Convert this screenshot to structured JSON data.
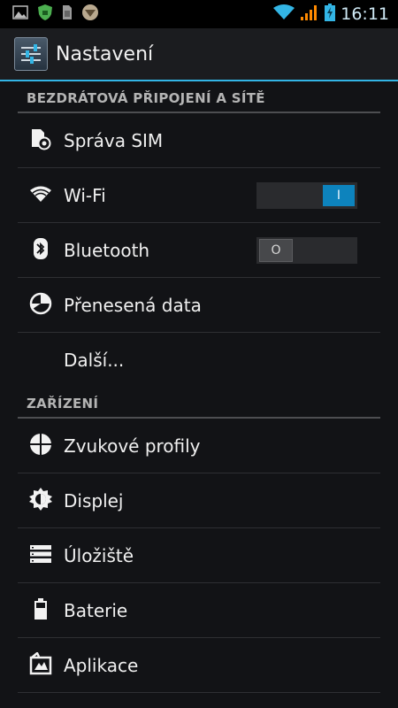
{
  "status_bar": {
    "time": "16:11",
    "icons": [
      "gallery-icon",
      "shield-icon",
      "sim-card-icon",
      "badge-icon",
      "wifi-icon",
      "signal-icon",
      "battery-charging-icon"
    ]
  },
  "action_bar": {
    "title": "Nastavení",
    "icon": "settings-sliders-icon"
  },
  "sections": [
    {
      "header": "BEZDRÁTOVÁ PŘIPOJENÍ A SÍTĚ",
      "items": [
        {
          "label": "Správa SIM",
          "icon": "sim-manage-icon"
        },
        {
          "label": "Wi-Fi",
          "icon": "wifi-icon",
          "toggle": "I",
          "toggle_state": "on"
        },
        {
          "label": "Bluetooth",
          "icon": "bluetooth-icon",
          "toggle": "O",
          "toggle_state": "off"
        },
        {
          "label": "Přenesená data",
          "icon": "data-usage-icon"
        },
        {
          "label": "Další...",
          "icon": ""
        }
      ]
    },
    {
      "header": "ZAŘÍZENÍ",
      "items": [
        {
          "label": "Zvukové profily",
          "icon": "sound-profiles-icon"
        },
        {
          "label": "Displej",
          "icon": "display-brightness-icon"
        },
        {
          "label": "Úložiště",
          "icon": "storage-icon"
        },
        {
          "label": "Baterie",
          "icon": "battery-icon"
        },
        {
          "label": "Aplikace",
          "icon": "apps-icon"
        }
      ]
    }
  ],
  "colors": {
    "accent": "#33b5e5",
    "toggle_on": "#0d83bd",
    "background": "#121316"
  }
}
